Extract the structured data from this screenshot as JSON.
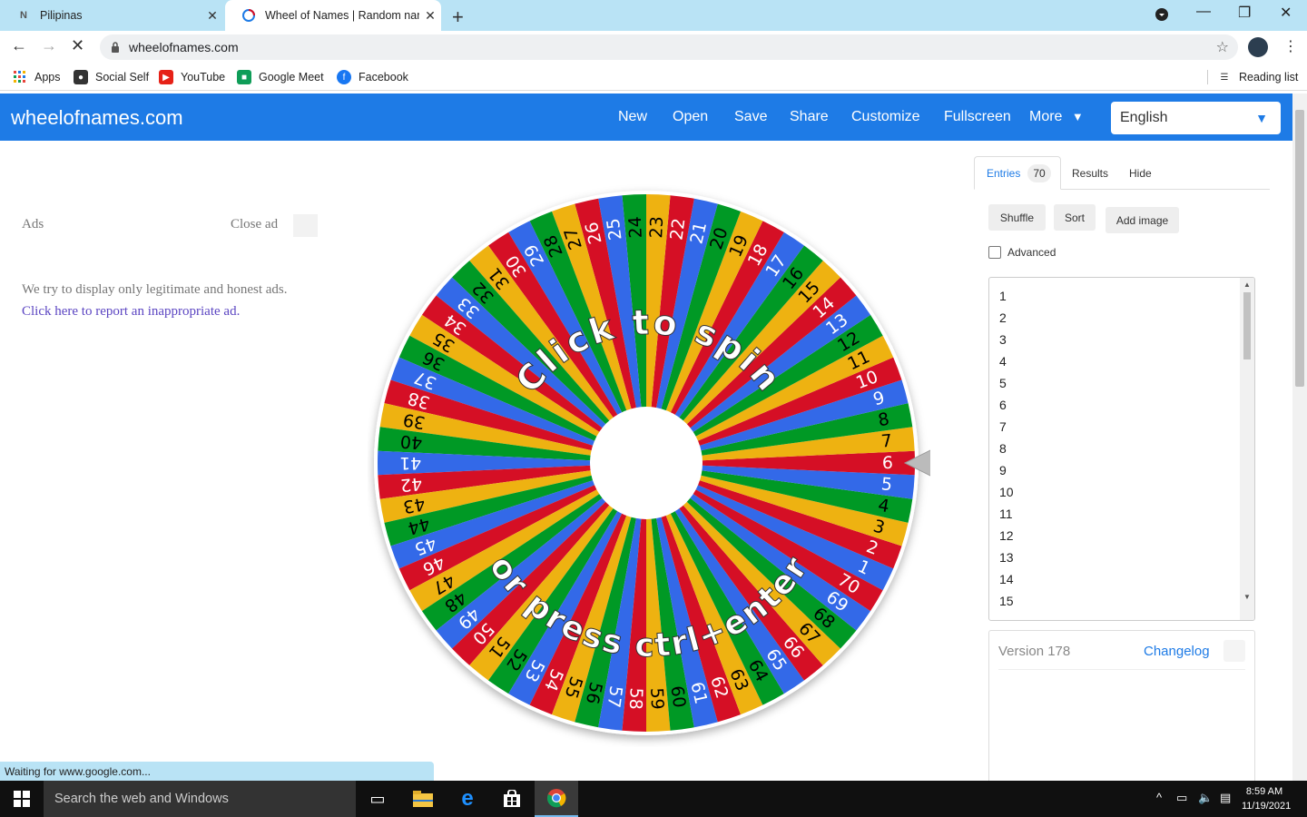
{
  "browser": {
    "tabs": [
      {
        "title": "Pilipinas",
        "active": false
      },
      {
        "title": "Wheel of Names | Random name",
        "active": true
      }
    ],
    "url": "wheelofnames.com",
    "bookmarks": [
      "Apps",
      "Social Self",
      "YouTube",
      "Google Meet",
      "Facebook"
    ],
    "reading_list": "Reading list",
    "status": "Waiting for www.google.com..."
  },
  "site": {
    "logo": "wheelofnames.com",
    "nav": [
      "New",
      "Open",
      "Save",
      "Share",
      "Customize",
      "Fullscreen",
      "More"
    ],
    "language": "English"
  },
  "ads": {
    "label": "Ads",
    "close": "Close ad",
    "note": "We try to display only legitimate and honest ads.",
    "report_link": "Click here to report an inappropriate ad."
  },
  "wheel": {
    "entry_count": 70,
    "text_top": "Click to spin",
    "text_bottom": "or press ctrl+enter",
    "colors": [
      "#3369e8",
      "#d50f25",
      "#eeb211",
      "#009925"
    ],
    "pointer_at_entry": "6"
  },
  "panel": {
    "tabs": {
      "entries": "Entries",
      "entries_count": "70",
      "results": "Results",
      "hide": "Hide"
    },
    "buttons": {
      "shuffle": "Shuffle",
      "sort": "Sort",
      "add_image": "Add image"
    },
    "advanced": "Advanced",
    "entries_visible": [
      "1",
      "2",
      "3",
      "4",
      "5",
      "6",
      "7",
      "8",
      "9",
      "10",
      "11",
      "12",
      "13",
      "14",
      "15"
    ],
    "version": "Version 178",
    "changelog": "Changelog"
  },
  "taskbar": {
    "search_placeholder": "Search the web and Windows",
    "time": "8:59 AM",
    "date": "11/19/2021"
  }
}
